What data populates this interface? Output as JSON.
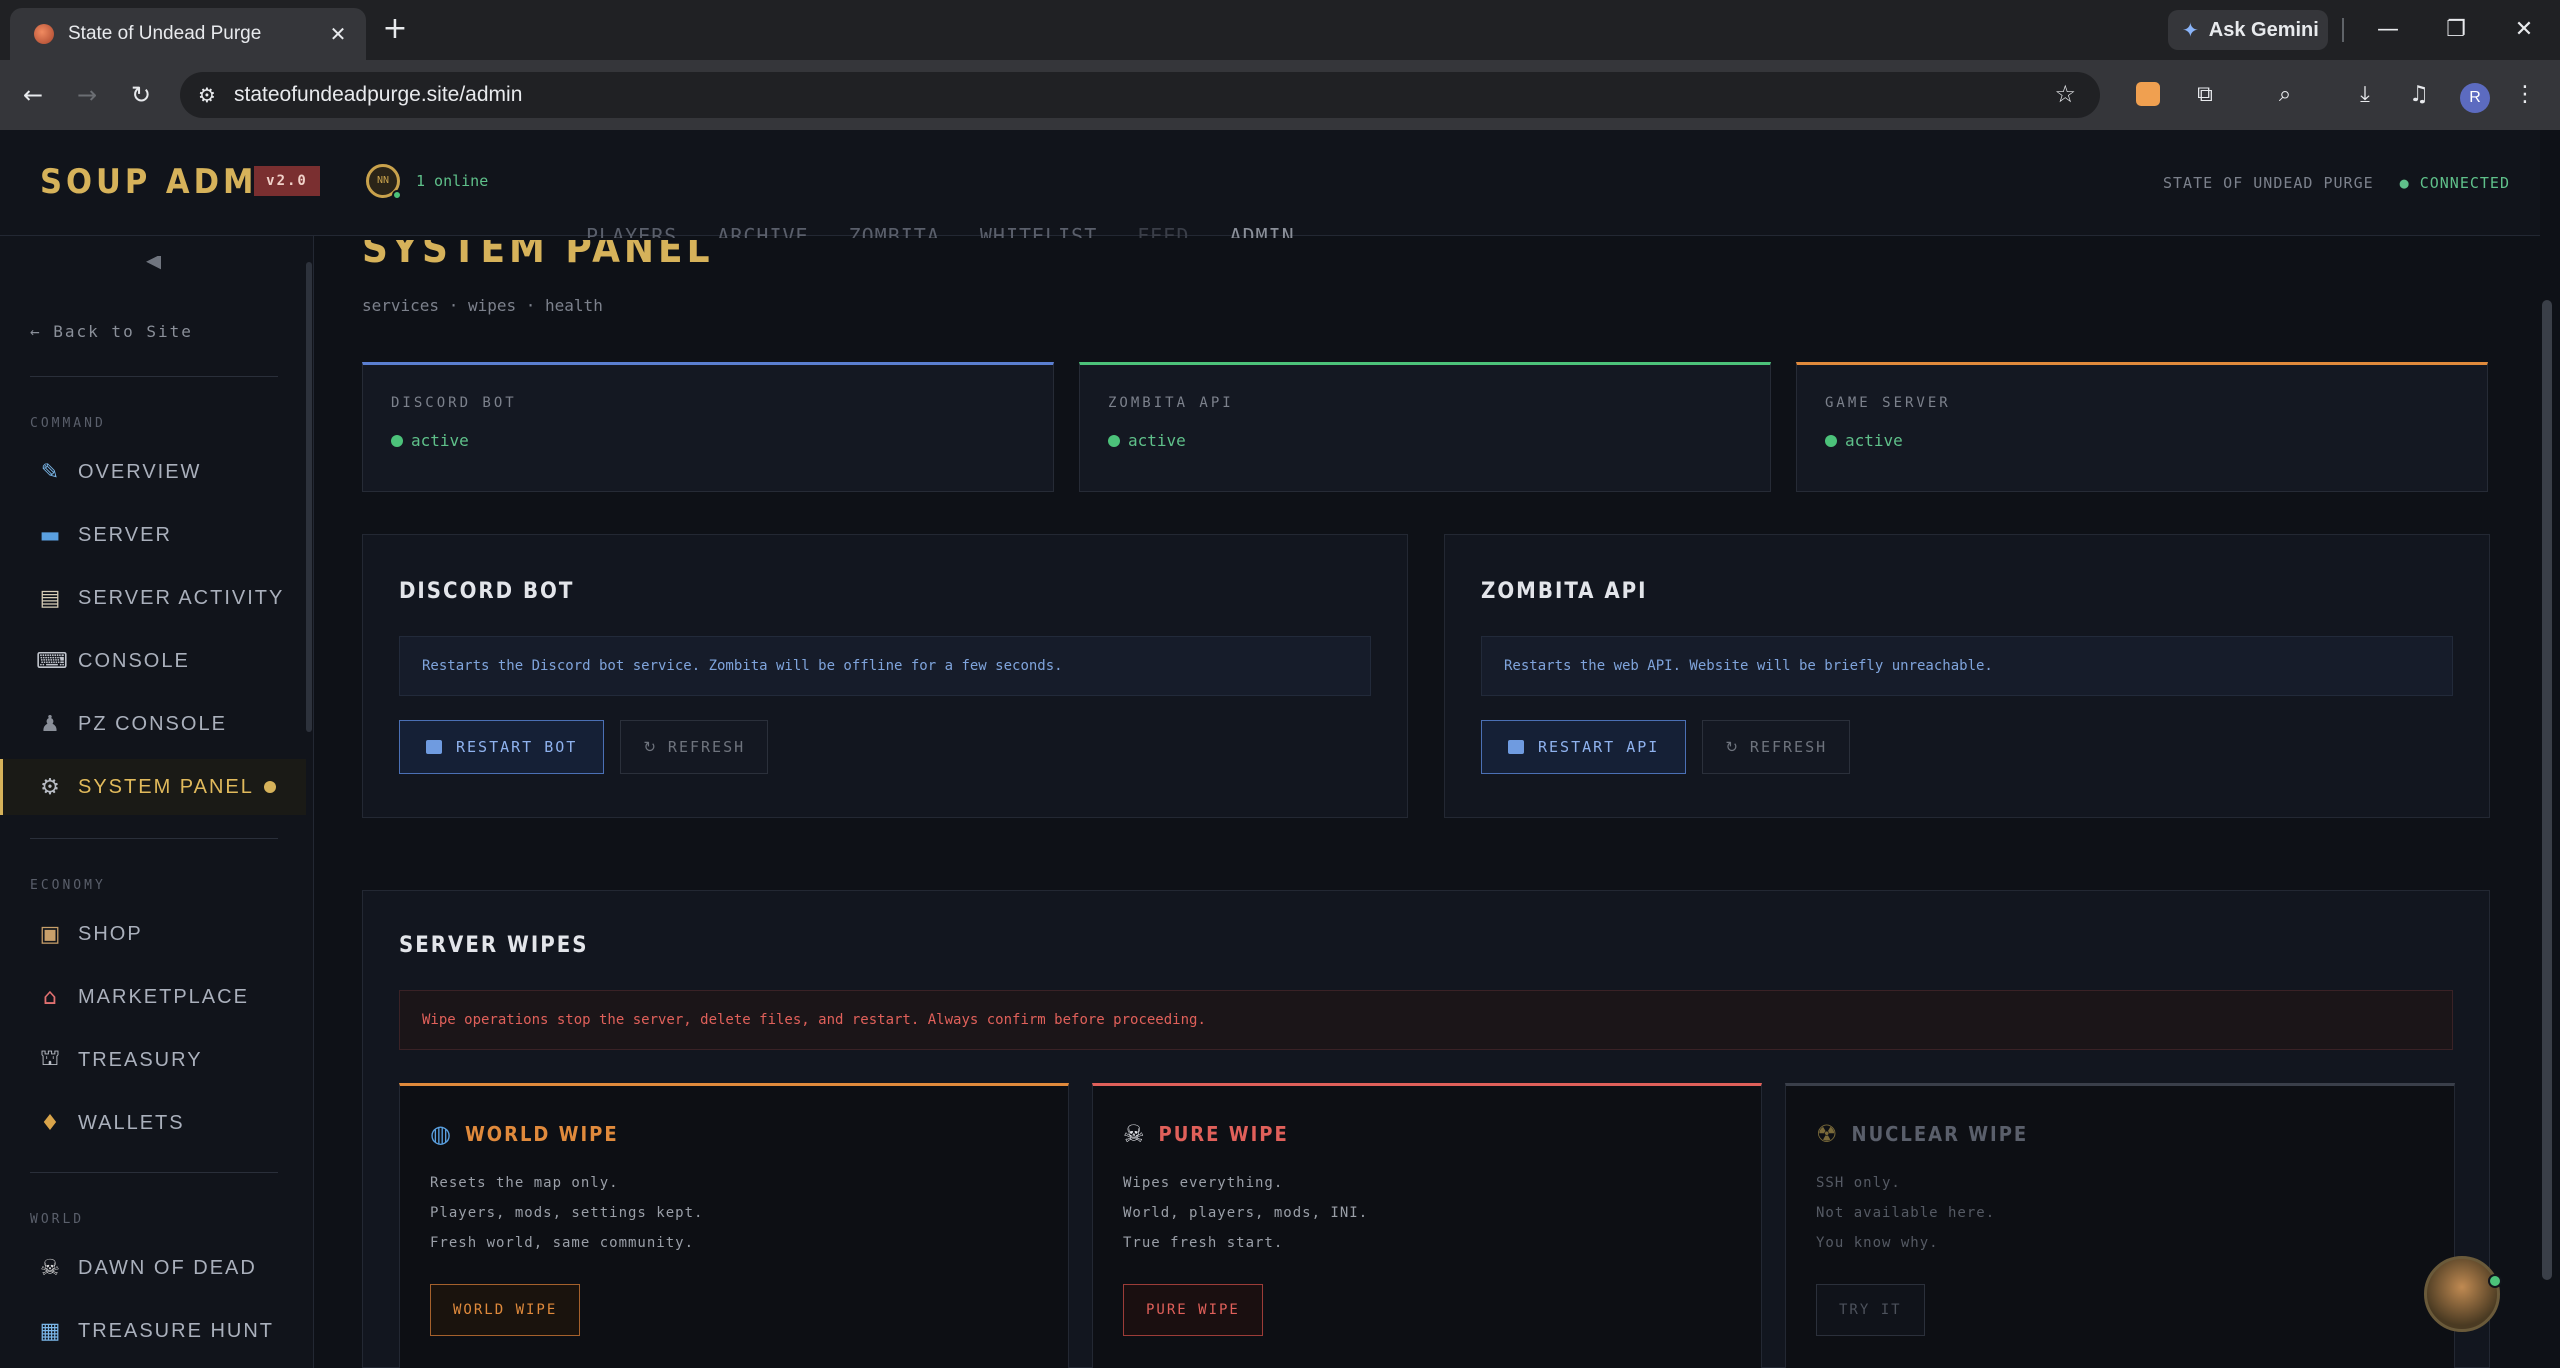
{
  "browser": {
    "tab_title": "State of Undead Purge",
    "url": "stateofundeadpurge.site/admin",
    "gemini_label": "Ask Gemini",
    "profile_initial": "R"
  },
  "header": {
    "brand": "SOUP ADMIN",
    "version": "v2.0",
    "online_count": "1 online",
    "game_name": "STATE OF UNDEAD PURGE",
    "connection_status": "● CONNECTED"
  },
  "top_nav": [
    "PLAYERS",
    "ARCHIVE",
    "ZOMBITA",
    "WHITELIST",
    "FEED",
    "ADMIN"
  ],
  "sidebar": {
    "back_link": "← Back to Site",
    "sections": [
      {
        "title": "COMMAND",
        "items": [
          {
            "label": "OVERVIEW",
            "icon": "chart-icon"
          },
          {
            "label": "SERVER",
            "icon": "monitor-icon"
          },
          {
            "label": "SERVER ACTIVITY",
            "icon": "clipboard-icon"
          },
          {
            "label": "CONSOLE",
            "icon": "keyboard-icon"
          },
          {
            "label": "PZ CONSOLE",
            "icon": "detective-icon"
          },
          {
            "label": "SYSTEM PANEL",
            "icon": "gear-icon",
            "active": true
          }
        ]
      },
      {
        "title": "ECONOMY",
        "items": [
          {
            "label": "SHOP",
            "icon": "package-icon"
          },
          {
            "label": "MARKETPLACE",
            "icon": "store-icon"
          },
          {
            "label": "TREASURY",
            "icon": "bank-icon"
          },
          {
            "label": "WALLETS",
            "icon": "money-bag-icon"
          }
        ]
      },
      {
        "title": "WORLD",
        "items": [
          {
            "label": "DAWN OF DEAD",
            "icon": "skull-icon"
          },
          {
            "label": "TREASURE HUNT",
            "icon": "map-icon"
          }
        ]
      }
    ]
  },
  "page": {
    "title": "SYSTEM PANEL",
    "subtitle": "services · wipes · health"
  },
  "status_cards": [
    {
      "label": "DISCORD BOT",
      "status": "active",
      "accent": "#5b7fd1"
    },
    {
      "label": "ZOMBITA API",
      "status": "active",
      "accent": "#4cc27a"
    },
    {
      "label": "GAME SERVER",
      "status": "active",
      "accent": "#e08a3c"
    }
  ],
  "services": [
    {
      "title": "DISCORD BOT",
      "note": "Restarts the Discord bot service. Zombita will be offline for a few seconds.",
      "primary_label": "RESTART BOT",
      "refresh_label": "REFRESH"
    },
    {
      "title": "ZOMBITA API",
      "note": "Restarts the web API. Website will be briefly unreachable.",
      "primary_label": "RESTART API",
      "refresh_label": "REFRESH"
    }
  ],
  "wipes": {
    "title": "SERVER WIPES",
    "warning": "Wipe operations stop the server, delete files, and restart. Always confirm before proceeding.",
    "cards": [
      {
        "name": "WORLD WIPE",
        "icon": "globe-icon",
        "accent": "#e08a3c",
        "lines": [
          "Resets the map only.",
          "Players, mods, settings kept.",
          "Fresh world, same community."
        ],
        "button": "WORLD WIPE"
      },
      {
        "name": "PURE WIPE",
        "icon": "skull-crossbones-icon",
        "accent": "#e0605a",
        "lines": [
          "Wipes everything.",
          "World, players, mods, INI.",
          "True fresh start."
        ],
        "button": "PURE WIPE"
      },
      {
        "name": "NUCLEAR WIPE",
        "icon": "radioactive-icon",
        "accent": "#3a3f4a",
        "lines": [
          "SSH only.",
          "Not available here.",
          "You know why."
        ],
        "button": "TRY IT"
      }
    ]
  }
}
